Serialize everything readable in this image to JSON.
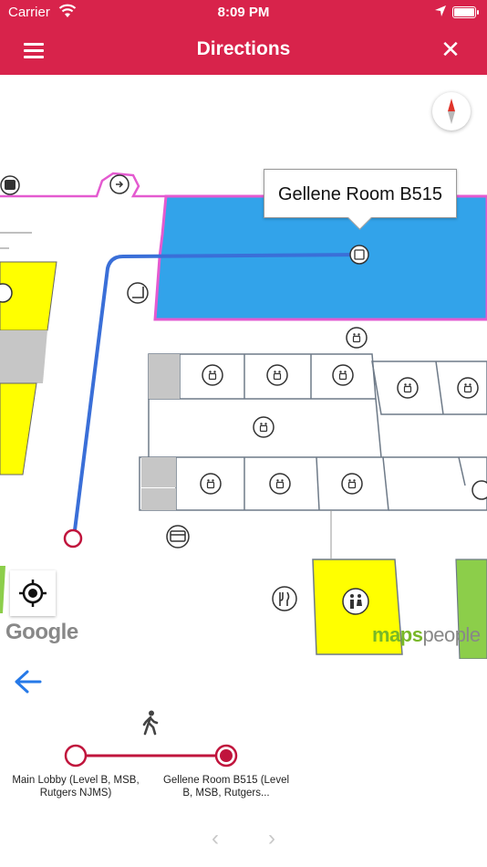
{
  "status_bar": {
    "carrier": "Carrier",
    "time": "8:09 PM"
  },
  "nav": {
    "title": "Directions",
    "menu_icon": "hamburger-menu-icon",
    "close_icon": "close-icon",
    "close_glyph": "✕"
  },
  "map": {
    "destination_callout": "Gellene Room B515",
    "google_logo": "Google",
    "mapspeople_logo_brand": "maps",
    "mapspeople_logo_suffix": "people",
    "colors": {
      "selected_room": "#32a3ea",
      "restroom_zone": "#ffff00",
      "green_zone": "#8cce4a",
      "route": "#3a6fd8",
      "building_outline": "#e45ad0",
      "gray_room": "#c6c6c6"
    }
  },
  "directions": {
    "back_icon": "back-arrow-icon",
    "mode_icon": "walking-person-icon",
    "origin_label": "Main Lobby (Level B, MSB, Rutgers NJMS)",
    "destination_label": "Gellene Room B515 (Level B, MSB, Rutgers...",
    "prev_glyph": "‹",
    "next_glyph": "›"
  },
  "accent": "#d8234b"
}
